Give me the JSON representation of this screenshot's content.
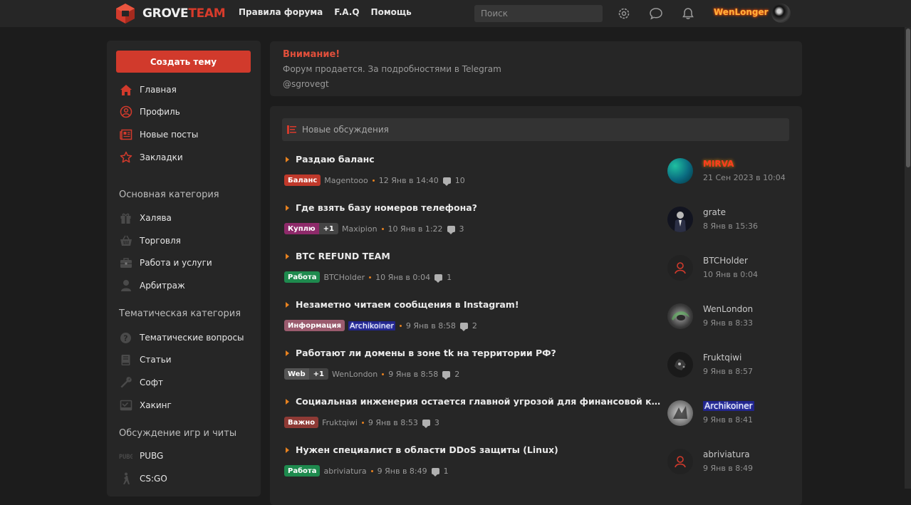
{
  "header": {
    "logo_text_1": "GROVE",
    "logo_text_2": "TEAM",
    "nav": [
      "Правила форума",
      "F.A.Q",
      "Помощь"
    ],
    "search_placeholder": "Поиск",
    "username": "WenLonger",
    "icons": [
      "gear-icon",
      "chat-bubble-icon",
      "bell-icon"
    ]
  },
  "sidebar": {
    "create_label": "Создать тему",
    "main_items": [
      {
        "label": "Главная",
        "icon": "home-icon"
      },
      {
        "label": "Профиль",
        "icon": "profile-icon"
      },
      {
        "label": "Новые посты",
        "icon": "newspaper-icon"
      },
      {
        "label": "Закладки",
        "icon": "star-icon"
      }
    ],
    "categories": [
      {
        "title": "Основная категория",
        "items": [
          {
            "label": "Халява",
            "icon": "gift-icon"
          },
          {
            "label": "Торговля",
            "icon": "basket-icon"
          },
          {
            "label": "Работа и услуги",
            "icon": "briefcase-icon"
          },
          {
            "label": "Арбитраж",
            "icon": "person-icon"
          }
        ]
      },
      {
        "title": "Тематическая категория",
        "items": [
          {
            "label": "Тематические вопросы",
            "icon": "question-icon"
          },
          {
            "label": "Статьи",
            "icon": "book-icon"
          },
          {
            "label": "Софт",
            "icon": "wrench-icon"
          },
          {
            "label": "Хакинг",
            "icon": "terminal-icon"
          }
        ]
      },
      {
        "title": "Обсуждение игр и читы",
        "items": [
          {
            "label": "PUBG",
            "icon": "pubg-icon"
          },
          {
            "label": "CS:GO",
            "icon": "csgo-icon"
          }
        ]
      }
    ]
  },
  "notice": {
    "title": "Внимание!",
    "text": "Форум продается. За подробностями в Telegram",
    "link": "@sgrovegt"
  },
  "threads_panel": {
    "title": "Новые обсуждения",
    "threads": [
      {
        "title": "Раздаю баланс",
        "tag": "Баланс",
        "tag_color": "#c0392b",
        "plus": "",
        "author": "Magentooo",
        "date": "12 Янв в 14:40",
        "replies": "10",
        "last_user": "MIRVA",
        "last_time": "21 Сен 2023 в 10:04"
      },
      {
        "title": "Где взять базу номеров телефона?",
        "tag": "Куплю",
        "tag_color": "#8e2a6a",
        "plus": "+1",
        "author": "Maxipion",
        "date": "10 Янв в 1:22",
        "replies": "3",
        "last_user": "grate",
        "last_time": "8 Янв в 15:36"
      },
      {
        "title": "BTC REFUND TEAM",
        "tag": "Работа",
        "tag_color": "#1e8a4e",
        "plus": "",
        "author": "BTCHolder",
        "date": "10 Янв в 0:04",
        "replies": "1",
        "last_user": "BTCHolder",
        "last_time": "10 Янв в 0:04"
      },
      {
        "title": "Незаметно читаем сообщения в Instagram!",
        "tag": "Информация",
        "tag_color": "#9a5b6e",
        "plus": "",
        "author": "Archikoiner",
        "date": "9 Янв в 8:58",
        "replies": "2",
        "last_user": "WenLondon",
        "last_time": "9 Янв в 8:33"
      },
      {
        "title": "Работают ли домены в зоне tk на территории РФ?",
        "tag": "Web",
        "tag_color": "#555555",
        "plus": "+1",
        "author": "WenLondon",
        "date": "9 Янв в 8:58",
        "replies": "2",
        "last_user": "Fruktqiwi",
        "last_time": "9 Янв в 8:57"
      },
      {
        "title": "Социальная инженерия остается главной угрозой для финансовой кибербезопасности",
        "tag": "Важно",
        "tag_color": "#8e3a35",
        "plus": "",
        "author": "Fruktqiwi",
        "date": "9 Янв в 8:53",
        "replies": "3",
        "last_user": "Archikoiner",
        "last_time": "9 Янв в 8:41"
      },
      {
        "title": "Нужен специалист в области DDoS защиты (Linux)",
        "tag": "Работа",
        "tag_color": "#1e8a4e",
        "plus": "",
        "author": "abriviatura",
        "date": "9 Янв в 8:49",
        "replies": "1",
        "last_user": "abriviatura",
        "last_time": "9 Янв в 8:49"
      }
    ]
  }
}
